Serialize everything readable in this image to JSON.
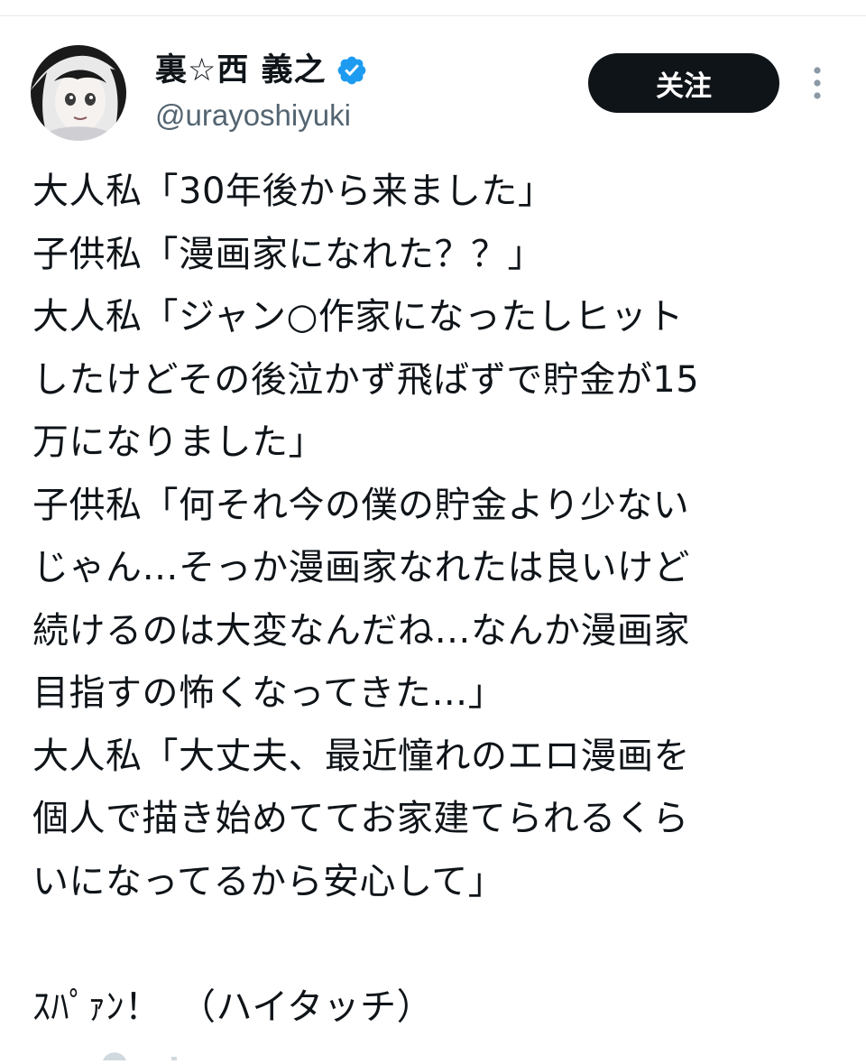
{
  "author": {
    "display_name": "裏☆西 義之",
    "handle": "@urayoshiyuki",
    "verified": true,
    "avatar_icon": "anime-girl-avatar-icon",
    "verified_icon": "verified-badge-icon"
  },
  "actions": {
    "follow_label": "关注",
    "more_icon": "more-vertical-icon"
  },
  "tweet": {
    "lines": [
      "大人私「30年後から来ました」",
      "子供私「漫画家になれた？？」",
      "大人私「ジャン○作家になったしヒット",
      "したけどその後泣かず飛ばずで貯金が15",
      "万になりました」",
      "子供私「何それ今の僕の貯金より少ない",
      "じゃん…そっか漫画家なれたは良いけど",
      "続けるのは大変なんだね…なんか漫画家",
      "目指すの怖くなってきた…」",
      "大人私「大丈夫、最近憧れのエロ漫画を",
      "個人で描き始めててお家建てられるくら",
      "いになってるから安心して」",
      "",
      "ｽﾊﾟｧﾝ！　（ハイタッチ）"
    ]
  },
  "colors": {
    "text": "#0f1419",
    "secondary_text": "#536471",
    "follow_bg": "#0f1419",
    "follow_text": "#ffffff",
    "verified": "#1d9bf0"
  }
}
